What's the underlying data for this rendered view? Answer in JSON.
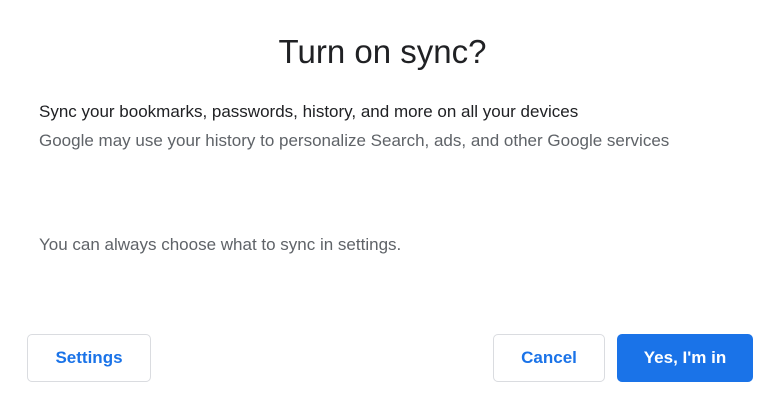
{
  "dialog": {
    "title": "Turn on sync?",
    "description": "Sync your bookmarks, passwords, history, and more on all your devices",
    "subdescription": "Google may use your history to personalize Search, ads, and other Google services",
    "settings_note": "You can always choose what to sync in settings.",
    "buttons": {
      "settings": "Settings",
      "cancel": "Cancel",
      "confirm": "Yes, I'm in"
    }
  },
  "colors": {
    "accent": "#1a73e8",
    "title_text": "#202124",
    "secondary_text": "#5f6368",
    "button_border": "#dadce0"
  }
}
